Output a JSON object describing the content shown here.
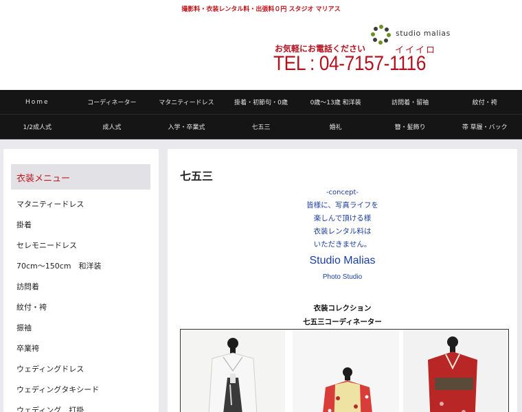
{
  "header": {
    "tagline": "撮影料・衣装レンタル料・出張料０円 スタジオ マリアス",
    "logo_text": "studio malias",
    "call_text": "お気軽にお電話ください",
    "kana_text": "イイイロ",
    "phone": "TEL : 04-7157-1116"
  },
  "nav": {
    "row1": [
      "Home",
      "コーディネーター",
      "マタニティードレス",
      "掛着・初節句・0歳",
      "0歳～13歳 和洋装",
      "訪問着・留袖",
      "紋付・袴"
    ],
    "row2": [
      "1/2成人式",
      "成人式",
      "入学・卒業式",
      "七五三",
      "婚礼",
      "簪・髪飾り",
      "帯 草履・バック"
    ]
  },
  "sidebar": {
    "heading": "衣装メニュー",
    "items": [
      "マタニティードレス",
      "掛着",
      "セレモニードレス",
      "70cm～150cm　和洋装",
      "訪問着",
      "紋付・袴",
      "振袖",
      "卒業袴",
      "ウェディングドレス",
      "ウェディングタキシード",
      "ウェディング　打掛"
    ]
  },
  "main": {
    "title": "七五三",
    "concept_label": "-concept-",
    "concept_lines": [
      "皆様に、写真ライフを",
      "楽しんで頂ける様",
      "衣装レンタル料は",
      "いただきません。"
    ],
    "studio_name": "Studio Malias",
    "photo_studio": "Photo Studio",
    "collection_title": "衣装コレクション",
    "collection_sub": "七五三コーディネーター"
  },
  "colors": {
    "brand_red": "#c0161b",
    "link_blue": "#1a3ea0",
    "nav_bg": "#151515"
  }
}
